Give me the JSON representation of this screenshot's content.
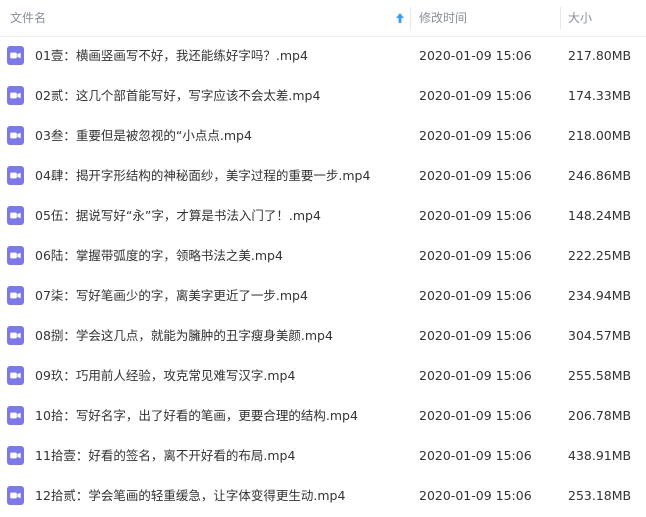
{
  "header": {
    "name_label": "文件名",
    "mtime_label": "修改时间",
    "size_label": "大小",
    "sort_icon": "arrow-up-icon"
  },
  "colors": {
    "accent": "#3b9ef8",
    "file_icon": "#7b79e6",
    "header_text": "#8a8f99",
    "text": "#333333"
  },
  "files": [
    {
      "name": "01壹：横画竖画写不好，我还能练好字吗？.mp4",
      "mtime": "2020-01-09 15:06",
      "size": "217.80MB",
      "icon": "video-file-icon"
    },
    {
      "name": "02贰：这几个部首能写好，写字应该不会太差.mp4",
      "mtime": "2020-01-09 15:06",
      "size": "174.33MB",
      "icon": "video-file-icon"
    },
    {
      "name": "03叁：重要但是被忽视的“小点点.mp4",
      "mtime": "2020-01-09 15:06",
      "size": "218.00MB",
      "icon": "video-file-icon"
    },
    {
      "name": "04肆：揭开字形结构的神秘面纱，美字过程的重要一步.mp4",
      "mtime": "2020-01-09 15:06",
      "size": "246.86MB",
      "icon": "video-file-icon"
    },
    {
      "name": "05伍：据说写好“永”字，才算是书法入门了！.mp4",
      "mtime": "2020-01-09 15:06",
      "size": "148.24MB",
      "icon": "video-file-icon"
    },
    {
      "name": "06陆：掌握带弧度的字，领略书法之美.mp4",
      "mtime": "2020-01-09 15:06",
      "size": "222.25MB",
      "icon": "video-file-icon"
    },
    {
      "name": "07柒：写好笔画少的字，离美字更近了一步.mp4",
      "mtime": "2020-01-09 15:06",
      "size": "234.94MB",
      "icon": "video-file-icon"
    },
    {
      "name": "08捌：学会这几点，就能为臃肿的丑字瘦身美颜.mp4",
      "mtime": "2020-01-09 15:06",
      "size": "304.57MB",
      "icon": "video-file-icon"
    },
    {
      "name": "09玖：巧用前人经验，攻克常见难写汉字.mp4",
      "mtime": "2020-01-09 15:06",
      "size": "255.58MB",
      "icon": "video-file-icon"
    },
    {
      "name": "10拾：写好名字，出了好看的笔画，更要合理的结构.mp4",
      "mtime": "2020-01-09 15:06",
      "size": "206.78MB",
      "icon": "video-file-icon"
    },
    {
      "name": "11拾壹：好看的签名，离不开好看的布局.mp4",
      "mtime": "2020-01-09 15:06",
      "size": "438.91MB",
      "icon": "video-file-icon"
    },
    {
      "name": "12拾贰：学会笔画的轻重缓急，让字体变得更生动.mp4",
      "mtime": "2020-01-09 15:06",
      "size": "253.18MB",
      "icon": "video-file-icon"
    }
  ]
}
